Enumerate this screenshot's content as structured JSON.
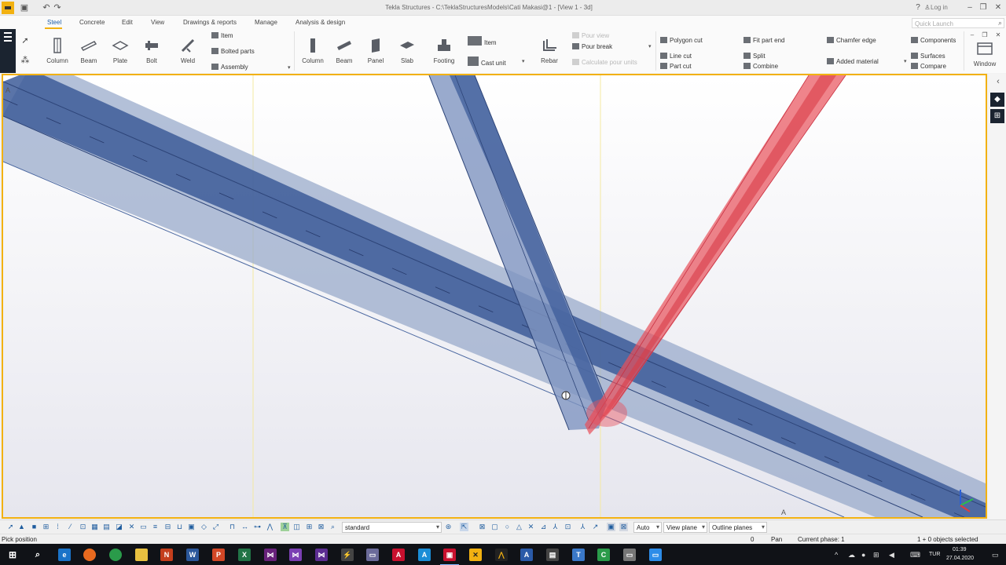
{
  "window": {
    "title": "Tekla Structures - C:\\TeklaStructuresModels\\Cati Makasi@1 - [View 1 - 3d]",
    "login_label": "Log in",
    "help_icon": "help-icon",
    "quick_launch_placeholder": "Quick Launch"
  },
  "menu": {
    "tabs": [
      {
        "label": "Steel",
        "active": true
      },
      {
        "label": "Concrete"
      },
      {
        "label": "Edit"
      },
      {
        "label": "View"
      },
      {
        "label": "Drawings & reports"
      },
      {
        "label": "Manage"
      },
      {
        "label": "Analysis & design"
      }
    ]
  },
  "ribbon": {
    "steel": {
      "column": "Column",
      "beam": "Beam",
      "plate": "Plate",
      "bolt": "Bolt",
      "weld": "Weld",
      "item": "Item",
      "bolted_parts": "Bolted parts",
      "assembly": "Assembly"
    },
    "concrete": {
      "column": "Column",
      "beam": "Beam",
      "panel": "Panel",
      "slab": "Slab",
      "footing": "Footing",
      "item": "Item",
      "cast_unit": "Cast unit",
      "rebar": "Rebar",
      "pour_view": "Pour view",
      "pour_break": "Pour break",
      "calculate_pour_units": "Calculate pour units"
    },
    "edit": {
      "polygon_cut": "Polygon cut",
      "line_cut": "Line cut",
      "part_cut": "Part cut",
      "fit_part_end": "Fit part end",
      "split": "Split",
      "combine": "Combine",
      "chamfer_edge": "Chamfer edge",
      "added_material": "Added material",
      "components": "Components",
      "surfaces": "Surfaces",
      "compare": "Compare",
      "window": "Window"
    }
  },
  "viewport": {
    "label_a_start": "A",
    "label_a_end": "A"
  },
  "bottom_toolbar": {
    "view_filter": "standard",
    "snap_mode": "Auto",
    "plane": "View plane",
    "outline": "Outline planes"
  },
  "status": {
    "prompt": "Pick position",
    "zero": "0",
    "mode": "Pan",
    "phase": "Current phase: 1",
    "selection": "1 + 0 objects selected"
  },
  "taskbar": {
    "language": "TUR",
    "time": "01:39",
    "date": "27.04.2020"
  },
  "colors": {
    "accent": "#f2b111",
    "steel_blue": "#3f5e9a",
    "highlight_red": "#e8505a",
    "rail_dark": "#1b2430"
  }
}
